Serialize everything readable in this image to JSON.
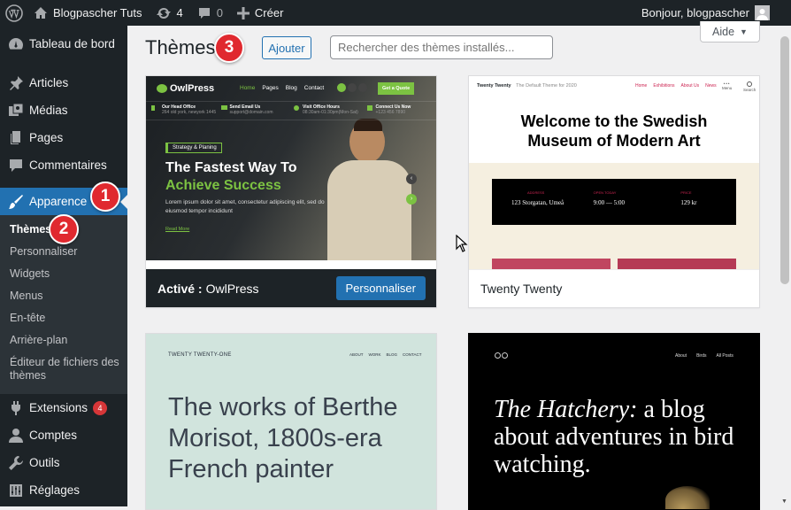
{
  "admin_bar": {
    "site_name": "Blogpascher Tuts",
    "updates_count": "4",
    "comments_count": "0",
    "new_label": "Créer",
    "greeting": "Bonjour, blogpascher"
  },
  "sidebar": {
    "items": [
      {
        "label": "Tableau de bord",
        "icon": "dashboard-icon"
      },
      {
        "label": "Articles",
        "icon": "pin-icon"
      },
      {
        "label": "Médias",
        "icon": "media-icon"
      },
      {
        "label": "Pages",
        "icon": "pages-icon"
      },
      {
        "label": "Commentaires",
        "icon": "comment-icon"
      },
      {
        "label": "Apparence",
        "icon": "brush-icon"
      },
      {
        "label": "Extensions",
        "icon": "plugin-icon",
        "badge": "4"
      },
      {
        "label": "Comptes",
        "icon": "user-icon"
      },
      {
        "label": "Outils",
        "icon": "wrench-icon"
      },
      {
        "label": "Réglages",
        "icon": "settings-icon"
      }
    ],
    "submenu": [
      "Thèmes",
      "Personnaliser",
      "Widgets",
      "Menus",
      "En-tête",
      "Arrière-plan",
      "Éditeur de fichiers des thèmes"
    ]
  },
  "steps": [
    "1",
    "2",
    "3"
  ],
  "main": {
    "title": "Thèmes",
    "add_label": "Ajouter",
    "search_placeholder": "Rechercher des thèmes installés...",
    "help_label": "Aide"
  },
  "themes": {
    "owlpress": {
      "active_prefix": "Activé :",
      "name": "OwlPress",
      "customize_label": "Personnaliser",
      "preview": {
        "logo": "OwlPress",
        "nav": [
          "Home",
          "Pages",
          "Blog",
          "Contact"
        ],
        "cta": "Get a Quote",
        "info": [
          {
            "title": "Our Head Office",
            "sub": "264 old york, newyork 1445"
          },
          {
            "title": "Send Email Us",
            "sub": "support@domain.com"
          },
          {
            "title": "Visit Office Hours",
            "sub": "08:30am-01:30pm(Mon-Sat)"
          },
          {
            "title": "Connect Us Now",
            "sub": "+123 456 7890"
          }
        ],
        "tag": "Strategy & Planing",
        "headline1": "The Fastest Way To",
        "headline2": "Achieve Success",
        "body": "Lorem ipsum dolor sit amet, consectetur adipiscing elit, sed do eiusmod tempor incididunt",
        "read_more": "Read More"
      }
    },
    "twentytwenty": {
      "name": "Twenty Twenty",
      "preview": {
        "brand": "Twenty Twenty",
        "tagline": "The Default Theme for 2020",
        "nav": [
          "Home",
          "Exhibitions",
          "About Us",
          "News"
        ],
        "menu_label": "Menu",
        "search_label": "Search",
        "headline": "Welcome to the Swedish Museum of Modern Art",
        "info": [
          {
            "label": "ADDRESS",
            "value": "123 Storgatan, Umeå"
          },
          {
            "label": "OPEN TODAY",
            "value": "9:00 — 5:00"
          },
          {
            "label": "PRICE",
            "value": "129 kr"
          }
        ]
      }
    },
    "twentytwentyone": {
      "preview": {
        "brand": "TWENTY TWENTY-ONE",
        "nav": [
          "ABOUT",
          "WORK",
          "BLOG",
          "CONTACT"
        ],
        "headline": "The works of Berthe Morisot, 1800s-era French painter"
      }
    },
    "twentytwentytwo": {
      "preview": {
        "nav": [
          "About",
          "Birds",
          "All Posts"
        ],
        "headline_italic": "The Hatchery:",
        "headline_rest": " a blog about adventures in bird watching."
      }
    }
  },
  "colors": {
    "admin_dark": "#1d2327",
    "accent_blue": "#2271b1",
    "step_red": "#e0292f",
    "owl_green": "#7cc242"
  }
}
